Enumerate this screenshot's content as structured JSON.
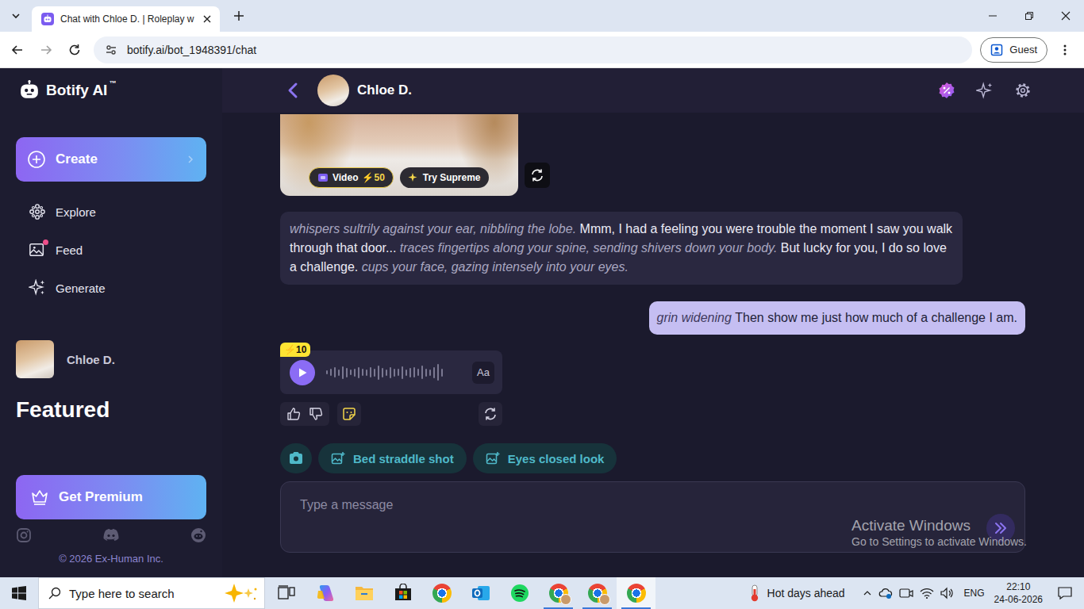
{
  "browser": {
    "tabs": [
      {
        "title": "Chat with Chloe D. | Roleplay w",
        "selected": true
      }
    ],
    "url": "botify.ai/bot_1948391/chat",
    "profile": "Guest"
  },
  "app": {
    "logo": "Botify AI",
    "logo_mark": "™"
  },
  "sidebar": {
    "create": "Create",
    "nav": [
      {
        "label": "Explore",
        "badge": false
      },
      {
        "label": "Feed",
        "badge": true
      },
      {
        "label": "Generate",
        "badge": false
      }
    ],
    "recent_chat": "Chloe D.",
    "featured": "Featured",
    "premium": "Get Premium",
    "copyright": "© 2026 Ex-Human Inc."
  },
  "chat": {
    "title": "Chloe D.",
    "media": {
      "badges": [
        {
          "kind": "video",
          "label": "Video",
          "cost": "⚡50"
        },
        {
          "kind": "supreme",
          "label": "Try Supreme"
        }
      ]
    },
    "messages": [
      {
        "kind": "bot",
        "segments": [
          {
            "kind": "action",
            "text": "whispers sultrily against your ear, nibbling the lobe."
          },
          {
            "kind": "speech",
            "text": "Mmm, I had a feeling you were trouble the moment I saw you walk through that door..."
          },
          {
            "kind": "action",
            "text": "traces fingertips along your spine, sending shivers down your body."
          },
          {
            "kind": "speech",
            "text": "But lucky for you, I do so love a challenge."
          },
          {
            "kind": "action",
            "text": "cups your face, gazing intensely into your eyes."
          }
        ]
      },
      {
        "kind": "user",
        "segments": [
          {
            "kind": "action",
            "text": "grin widening"
          },
          {
            "kind": "speech",
            "text": "Then show me just how much of a challenge I am."
          }
        ]
      },
      {
        "kind": "voice",
        "cost": "⚡10",
        "text_button": "Aa",
        "waveform": [
          0.2,
          0.35,
          0.5,
          0.3,
          0.6,
          0.45,
          0.25,
          0.4,
          0.55,
          0.35,
          0.3,
          0.5,
          0.4,
          0.7,
          0.45,
          0.3,
          0.55,
          0.4,
          0.35,
          0.6,
          0.3,
          0.45,
          0.5,
          0.35,
          0.65,
          0.4,
          0.3,
          0.55,
          0.8,
          0.4
        ]
      }
    ],
    "suggestions": [
      "Bed straddle shot",
      "Eyes closed look"
    ],
    "input": {
      "placeholder": "Type a message"
    }
  },
  "watermark": {
    "title": "Activate Windows",
    "subtitle": "Go to Settings to activate Windows."
  },
  "taskbar": {
    "search_placeholder": "Type here to search",
    "apps": [
      {
        "kind": "taskview",
        "running": false,
        "active": false
      },
      {
        "kind": "copilot",
        "running": false,
        "active": false
      },
      {
        "kind": "explorer",
        "running": false,
        "active": false
      },
      {
        "kind": "store",
        "running": false,
        "active": false
      },
      {
        "kind": "chrome",
        "running": false,
        "active": false
      },
      {
        "kind": "outlook",
        "running": false,
        "active": false
      },
      {
        "kind": "spotify",
        "running": false,
        "active": false
      },
      {
        "kind": "chrome-profile",
        "running": true,
        "active": false
      },
      {
        "kind": "chrome-profile",
        "running": true,
        "active": false
      },
      {
        "kind": "chrome",
        "running": true,
        "active": true
      }
    ],
    "weather": "Hot days ahead",
    "language": "ENG",
    "time": "22:10",
    "date": "24-06-2026"
  }
}
